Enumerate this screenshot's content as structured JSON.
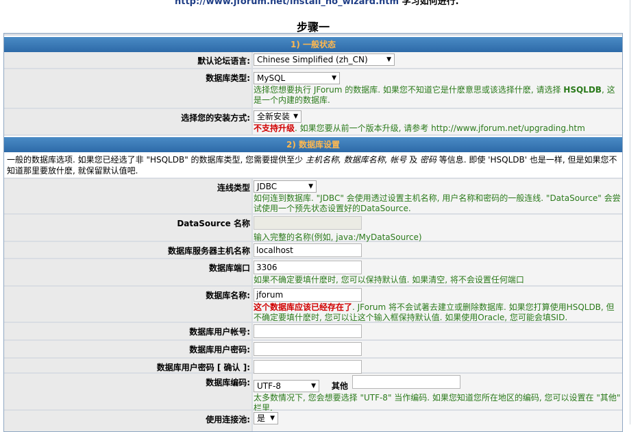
{
  "top": {
    "url": "http://www.jforum.net/install_no_wizard.htm",
    "url_tail": "学习如何进行."
  },
  "step_title": "步骤一",
  "section1": {
    "title": "1) 一般状态"
  },
  "language": {
    "label": "默认论坛语言:",
    "value": "Chinese Simplified (zh_CN)"
  },
  "dbtype": {
    "label": "数据库类型:",
    "value": "MySQL",
    "help_1": "选择您想要执行 JForum 的数据库. 如果您不知道它是什麽意思或该选择什麽, 请选择 ",
    "help_bold": "HSQLDB",
    "help_2": ", 这是一个内建的数据库."
  },
  "install": {
    "label": "选择您的安装方式:",
    "value": "全新安装",
    "warn": "不支持升级",
    "help": ". 如果您要从前一个版本升级, 请参考 ",
    "link": "http://www.jforum.net/upgrading.htm"
  },
  "section2": {
    "title": "2) 数据库设置",
    "desc_1": "一般的数据库选项. 如果您已经选了非 \"HSQLDB\" 的数据库类型, 您需要提供至少 ",
    "desc_it1": "主机名称, 数据库名称, 帐号",
    "desc_and": " 及 ",
    "desc_it2": "密码",
    "desc_2": " 等信息. 即使 'HSQLDB' 也是一样, 但是如果您不知道那里要放什麽, 就保留默认值吧."
  },
  "conn": {
    "label": "连线类型",
    "value": "JDBC",
    "help": "如何连到数据库. \"JDBC\" 会使用透过设置主机名称, 用户名称和密码的一般连线. \"DataSource\" 会尝试使用一个预先状态设置好的DataSource."
  },
  "datasource": {
    "label": "DataSource 名称",
    "value": "",
    "help": "输入完整的名称(例如, java:/MyDataSource)"
  },
  "host": {
    "label": "数据库服务器主机名称",
    "value": "localhost"
  },
  "port": {
    "label": "数据库端口",
    "value": "3306",
    "help": "如果不确定要填什麽时, 您可以保持默认值. 如果清空, 将不会设置任何端口"
  },
  "dbname": {
    "label": "数据库名称:",
    "value": "jforum",
    "warn": "这个数据库应该已经存在了",
    "help": ". JForum 将不会试著去建立或删除数据库. 如果您打算使用HSQLDB, 但不确定要填什麽时, 您可以让这个输入框保持默认值. 如果使用Oracle, 您可能会填SID."
  },
  "user": {
    "label": "数据库用户帐号:",
    "value": ""
  },
  "pass": {
    "label": "数据库用户密码:",
    "value": ""
  },
  "pass2": {
    "label": "数据库用户密码 [ 确认 ]:",
    "value": ""
  },
  "encoding": {
    "label": "数据库编码:",
    "value": "UTF-8",
    "other_label": "其他",
    "other_value": "",
    "help": "太多数情况下, 您会想要选择 \"UTF-8\" 当作编码. 如果您知道您所在地区的编码, 您可以设置在 \"其他\" 栏里."
  },
  "pool": {
    "label": "使用连接池:",
    "value": "是"
  },
  "colors": {
    "header_top": "#4a8bc5",
    "header_bottom": "#2d6aa8",
    "header_text": "#ffb84f",
    "help_text": "#2b7a1b",
    "warn_text": "#d10000"
  }
}
